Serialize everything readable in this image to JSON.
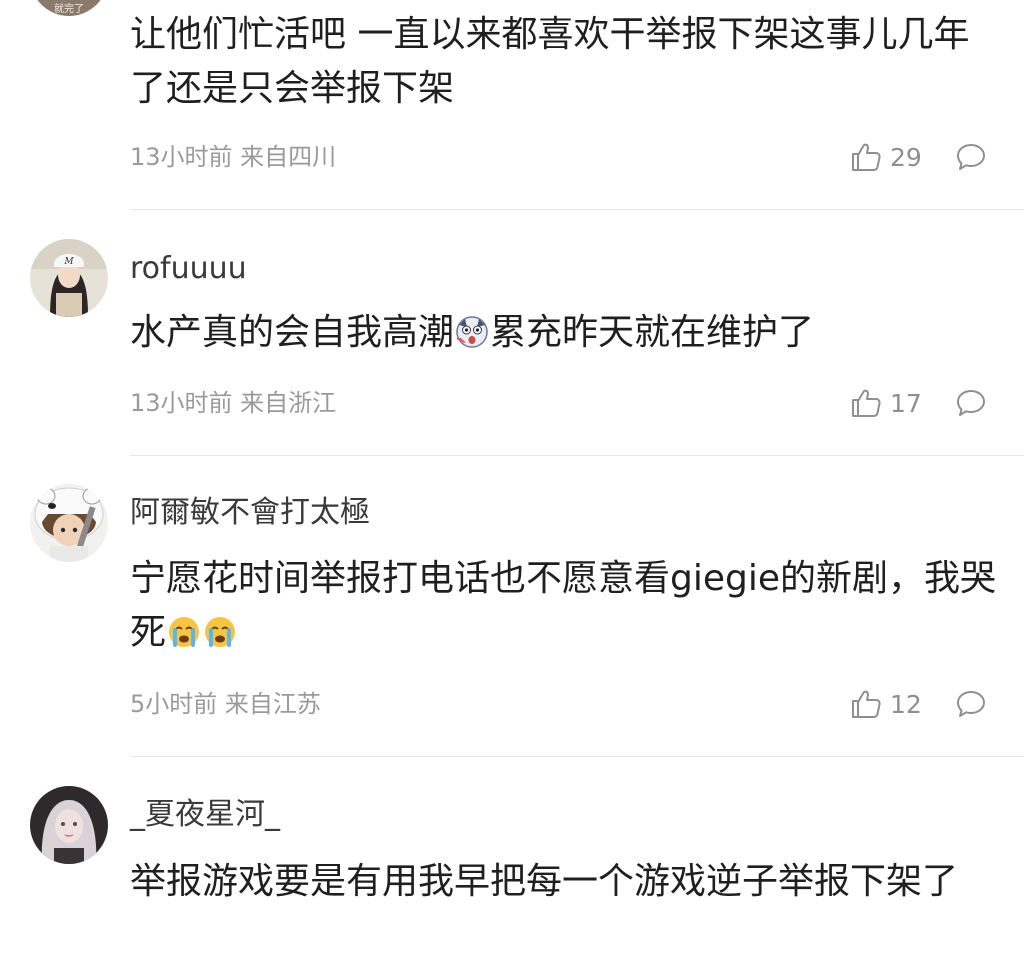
{
  "comments": [
    {
      "username": "",
      "avatar_label": "就完了",
      "text": "让他们忙活吧 一直以来都喜欢干举报下架这事儿几年了还是只会举报下架",
      "time": "13小时前 来自四川",
      "likes": "29"
    },
    {
      "username": "rofuuuu",
      "avatar_label": "M",
      "text_before_emoji": "水产真的会自我高潮",
      "emoji": "dog-shocked-emoji",
      "text_after_emoji": "累充昨天就在维护了",
      "time": "13小时前 来自浙江",
      "likes": "17"
    },
    {
      "username": "阿爾敏不會打太極",
      "text": "宁愿花时间举报打电话也不愿意看giegie的新剧，我哭死",
      "emojis": [
        "crying-face-emoji",
        "crying-face-emoji"
      ],
      "time": "5小时前 来自江苏",
      "likes": "12"
    },
    {
      "username": "_夏夜星河_",
      "text": "举报游戏要是有用我早把每一个游戏逆子举报下架了"
    }
  ],
  "icons": {
    "like": "thumbs-up-outline-icon",
    "reply": "speech-bubble-outline-icon"
  },
  "colors": {
    "text": "#1f1f1f",
    "meta": "#9a9a9a",
    "divider": "#e6e6e6"
  }
}
